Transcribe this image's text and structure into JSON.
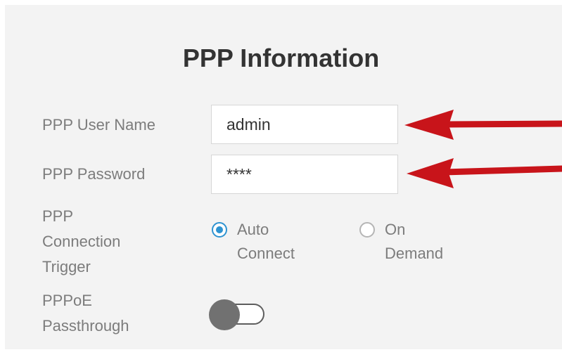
{
  "title": "PPP Information",
  "fields": {
    "username": {
      "label": "PPP User Name",
      "value": "admin"
    },
    "password": {
      "label": "PPP Password",
      "value": "****"
    }
  },
  "trigger": {
    "label_lines": [
      "PPP",
      "Connection",
      "Trigger"
    ],
    "options": [
      {
        "lines": [
          "Auto",
          "Connect"
        ],
        "selected": true
      },
      {
        "lines": [
          "On",
          "Demand"
        ],
        "selected": false
      }
    ]
  },
  "passthrough": {
    "label_lines": [
      "PPPoE",
      "Passthrough"
    ],
    "enabled": false
  },
  "colors": {
    "accent": "#2e93d1",
    "arrow": "#c8141a",
    "label": "#7c7c7c",
    "title": "#333333",
    "panel_bg": "#f3f3f3"
  }
}
